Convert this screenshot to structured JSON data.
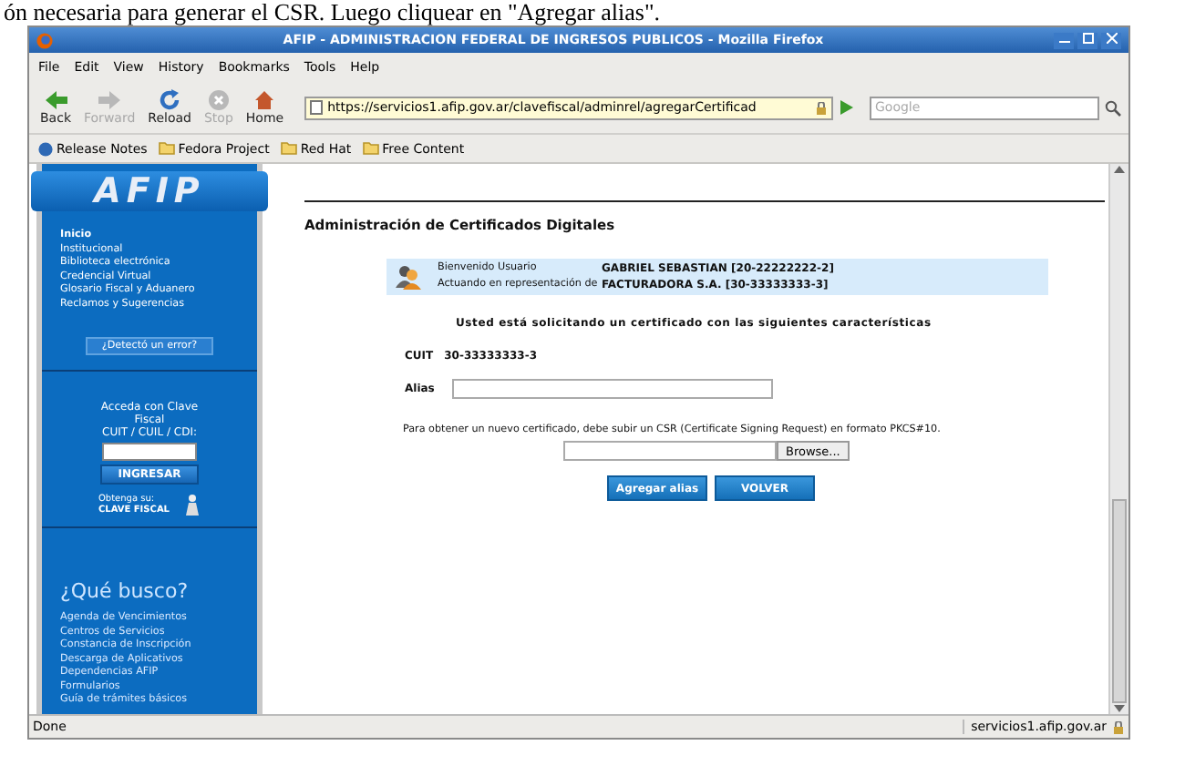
{
  "caption": "ón necesaria para generar el CSR. Luego cliquear en \"Agregar alias\".",
  "window": {
    "title": "AFIP - ADMINISTRACION FEDERAL DE INGRESOS PUBLICOS - Mozilla Firefox"
  },
  "menu": [
    "File",
    "Edit",
    "View",
    "History",
    "Bookmarks",
    "Tools",
    "Help"
  ],
  "toolbar": [
    {
      "label": "Back",
      "kind": "back",
      "disabled": false
    },
    {
      "label": "Forward",
      "kind": "forward",
      "disabled": true
    },
    {
      "label": "Reload",
      "kind": "reload",
      "disabled": false
    },
    {
      "label": "Stop",
      "kind": "stop",
      "disabled": true
    },
    {
      "label": "Home",
      "kind": "home",
      "disabled": false
    }
  ],
  "address": "https://servicios1.afip.gov.ar/clavefiscal/adminrel/agregarCertificad",
  "search": {
    "placeholder": "Google"
  },
  "bookmarks": [
    {
      "label": "Release Notes",
      "kind": "site"
    },
    {
      "label": "Fedora Project",
      "kind": "folder"
    },
    {
      "label": "Red Hat",
      "kind": "folder"
    },
    {
      "label": "Free Content",
      "kind": "folder"
    }
  ],
  "sidebar": {
    "logo": "AFIP",
    "nav": [
      {
        "label": "Inicio",
        "selected": true
      },
      {
        "label": "Institucional",
        "selected": false
      },
      {
        "label": "Biblioteca electrónica",
        "selected": false
      },
      {
        "label": "Credencial Virtual",
        "selected": false
      },
      {
        "label": "Glosario Fiscal y Aduanero",
        "selected": false
      },
      {
        "label": "Reclamos y Sugerencias",
        "selected": false
      }
    ],
    "error_button": "¿Detectó un error?",
    "login": {
      "prompt": "Acceda con Clave Fiscal",
      "field_label": "CUIT / CUIL / CDI:",
      "button": "INGRESAR",
      "obtain": "Obtenga su:",
      "obtain_strong": "CLAVE FISCAL"
    },
    "search_title": "¿Qué busco?",
    "links": [
      "Agenda de Vencimientos",
      "Centros de Servicios",
      "Constancia de Inscripción",
      "Descarga de Aplicativos",
      "Dependencias AFIP",
      "Formularios",
      "Guía de trámites básicos"
    ]
  },
  "main": {
    "heading": "Administración de Certificados Digitales",
    "user_box": [
      {
        "label": "Bienvenido Usuario",
        "value": "GABRIEL SEBASTIAN [20-22222222-2]"
      },
      {
        "label": "Actuando en representación de",
        "value": "FACTURADORA S.A. [30-33333333-3]"
      }
    ],
    "notice": "Usted está solicitando un certificado con las siguientes características",
    "cuit_label": "CUIT",
    "cuit_value": "30-33333333-3",
    "alias_label": "Alias",
    "csr_text": "Para obtener un nuevo certificado, debe subir un CSR (Certificate Signing Request) en formato PKCS#10.",
    "browse": "Browse...",
    "buttons": [
      "Agregar alias",
      "VOLVER"
    ]
  },
  "status_bar": {
    "text": "Done",
    "host": "servicios1.afip.gov.ar"
  }
}
